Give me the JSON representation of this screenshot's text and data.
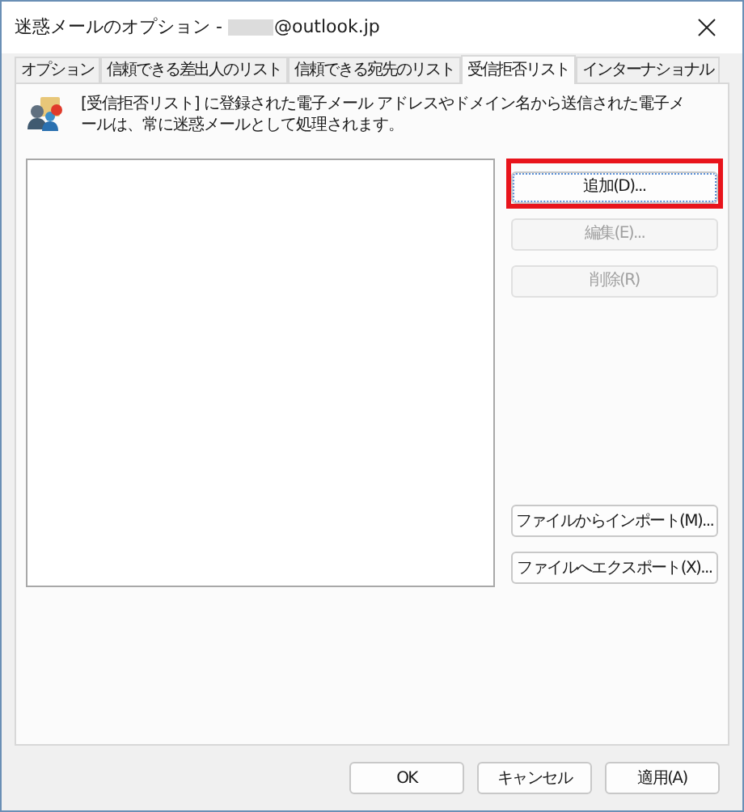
{
  "window": {
    "title_prefix": "迷惑メールのオプション -",
    "title_redacted": true,
    "title_suffix": "@outlook.jp"
  },
  "tabs": [
    {
      "label": "オプション",
      "selected": false
    },
    {
      "label": "信頼できる差出人のリスト",
      "selected": false
    },
    {
      "label": "信頼できる宛先のリスト",
      "selected": false
    },
    {
      "label": "受信拒否リスト",
      "selected": true
    },
    {
      "label": "インターナショナル",
      "selected": false
    }
  ],
  "description": "[受信拒否リスト] に登録された電子メール アドレスやドメイン名から送信された電子メールは、常に迷惑メールとして処理されます。",
  "top_buttons": [
    {
      "label": "追加(D)...",
      "disabled": false,
      "highlighted": true
    },
    {
      "label": "編集(E)...",
      "disabled": true,
      "highlighted": false
    },
    {
      "label": "削除(R)",
      "disabled": true,
      "highlighted": false
    }
  ],
  "bottom_side_buttons": [
    {
      "label": "ファイルからインポート(M)...",
      "disabled": false,
      "highlighted": false
    },
    {
      "label": "ファイルへエクスポート(X)...",
      "disabled": false,
      "highlighted": false
    }
  ],
  "dialog_buttons": [
    {
      "label": "OK",
      "disabled": false,
      "highlighted": false
    },
    {
      "label": "キャンセル",
      "disabled": false,
      "highlighted": false
    },
    {
      "label": "適用(A)",
      "disabled": false,
      "highlighted": false
    }
  ]
}
